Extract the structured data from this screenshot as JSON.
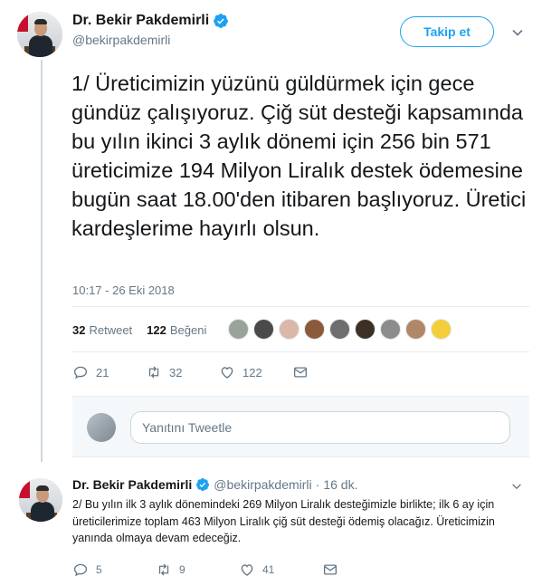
{
  "tweet": {
    "display_name": "Dr. Bekir Pakdemirli",
    "handle": "@bekirpakdemirli",
    "follow_label": "Takip et",
    "text": "1/ Üreticimizin yüzünü güldürmek için gece gündüz çalışıyoruz. Çiğ süt desteği kapsamında bu yılın ikinci 3 aylık dönemi için 256 bin 571 üreticimize 194 Milyon Liralık destek ödemesine bugün saat 18.00'den itibaren başlıyoruz.  Üretici kardeşlerime hayırlı olsun.",
    "timestamp": "10:17 - 26 Eki 2018",
    "retweets_count": "32",
    "retweets_label": "Retweet",
    "likes_count": "122",
    "likes_label": "Beğeni",
    "actions": {
      "replies": "21",
      "retweets": "32",
      "likes": "122"
    }
  },
  "reply_box": {
    "placeholder": "Yanıtını Tweetle"
  },
  "reply_tweet": {
    "display_name": "Dr. Bekir Pakdemirli",
    "handle": "@bekirpakdemirli",
    "separator": "·",
    "time": "16 dk.",
    "text": "2/  Bu yılın ilk 3 aylık dönemindeki 269 Milyon Liralık desteğimizle birlikte; ilk 6 ay için üreticilerimize toplam 463 Milyon Liralık çiğ süt desteği ödemiş olacağız. Üreticimizin yanında olmaya devam edeceğiz.",
    "actions": {
      "replies": "5",
      "retweets": "9",
      "likes": "41"
    }
  },
  "colors": {
    "accent": "#1da1f2",
    "muted": "#657786",
    "text": "#14171a",
    "border": "#e6ecf0"
  },
  "likers": [
    "#9aa39a",
    "#4a4a4a",
    "#d9b8a8",
    "#8a5a3a",
    "#6e6e6e",
    "#3c3024",
    "#8c8c8c",
    "#b08868",
    "#f2cf3a"
  ]
}
